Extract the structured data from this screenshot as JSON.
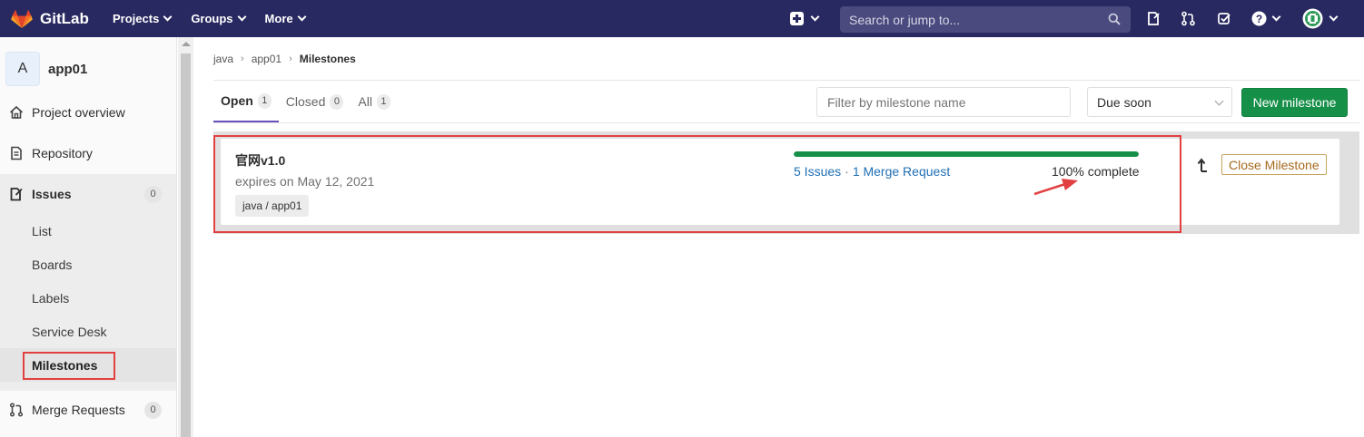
{
  "navbar": {
    "brand": "GitLab",
    "menu": [
      {
        "label": "Projects"
      },
      {
        "label": "Groups"
      },
      {
        "label": "More"
      }
    ],
    "search_placeholder": "Search or jump to..."
  },
  "sidebar": {
    "project_initial": "A",
    "project_name": "app01",
    "items": [
      {
        "label": "Project overview",
        "icon": "home-icon"
      },
      {
        "label": "Repository",
        "icon": "document-icon"
      },
      {
        "label": "Issues",
        "icon": "issues-icon",
        "count": "0"
      },
      {
        "label": "Merge Requests",
        "icon": "merge-request-icon",
        "count": "0"
      }
    ],
    "issues_sub": [
      "List",
      "Boards",
      "Labels",
      "Service Desk",
      "Milestones"
    ]
  },
  "breadcrumb": [
    "java",
    "app01",
    "Milestones"
  ],
  "tabs": [
    {
      "label": "Open",
      "count": "1"
    },
    {
      "label": "Closed",
      "count": "0"
    },
    {
      "label": "All",
      "count": "1"
    }
  ],
  "filter": {
    "placeholder": "Filter by milestone name"
  },
  "sort": {
    "selected": "Due soon"
  },
  "new_milestone_label": "New milestone",
  "milestone": {
    "title": "官网v1.0",
    "expires": "expires on May 12, 2021",
    "path": "java / app01",
    "issues_link": "5 Issues",
    "separator": "·",
    "merge_link": "1 Merge Request",
    "complete_text": "100% complete",
    "progress_percent": 100,
    "close_label": "Close Milestone"
  },
  "colors": {
    "navbar": "#292961",
    "accent_green": "#168f48",
    "link_blue": "#1f6fb5",
    "annotation_red": "#e24040"
  }
}
